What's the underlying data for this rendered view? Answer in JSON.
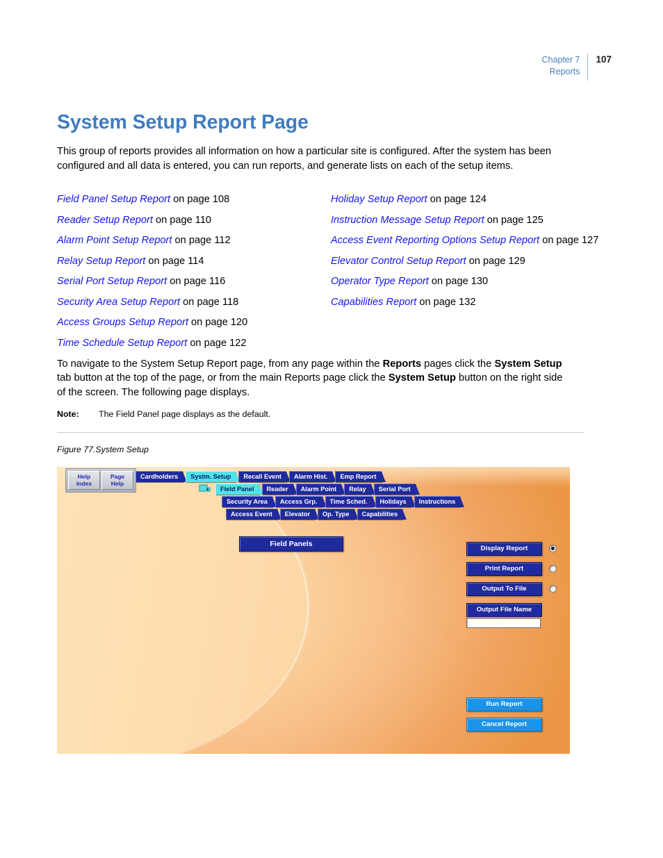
{
  "header": {
    "chapter": "Chapter 7",
    "section": "Reports",
    "page_number": "107"
  },
  "page": {
    "title": "System Setup Report Page",
    "intro": "This group of reports provides all information on how a particular site is configured. After the system has been configured and all data is entered, you can run reports, and generate lists on each of the setup items.",
    "navigate_1": "To navigate to the System Setup Report page, from any page within the ",
    "navigate_b1": "Reports",
    "navigate_2": " pages click the ",
    "navigate_b2": "System Setup",
    "navigate_3": " tab button at the top of the page, or from the main Reports page click the ",
    "navigate_b3": "System Setup",
    "navigate_4": " button on the right side of the screen. The following page displays.",
    "note_label": "Note:",
    "note_text": "The Field Panel page displays as the default.",
    "figure_caption": "Figure 77.System Setup"
  },
  "xref": {
    "left": [
      {
        "link": "Field Panel Setup Report",
        "tail": " on page 108"
      },
      {
        "link": "Reader Setup Report",
        "tail": " on page 110"
      },
      {
        "link": "Alarm Point Setup Report",
        "tail": " on page 112"
      },
      {
        "link": "Relay Setup Report",
        "tail": " on page 114"
      },
      {
        "link": "Serial Port Setup Report",
        "tail": " on page 116"
      },
      {
        "link": "Security Area Setup Report",
        "tail": " on page 118"
      },
      {
        "link": "Access Groups Setup Report",
        "tail": " on page 120"
      },
      {
        "link": "Time Schedule Setup Report",
        "tail": " on page 122"
      }
    ],
    "right": [
      {
        "link": "Holiday Setup Report",
        "tail": " on page 124"
      },
      {
        "link": "Instruction Message Setup Report",
        "tail": " on page 125"
      },
      {
        "link": "Access Event Reporting Options Setup Report",
        "tail": " on page 127"
      },
      {
        "link": "Elevator Control Setup Report",
        "tail": " on page 129"
      },
      {
        "link": "Operator Type Report",
        "tail": " on page 130"
      },
      {
        "link": "Capabilities Report",
        "tail": " on page 132"
      }
    ]
  },
  "appshot": {
    "help_buttons": [
      {
        "line1": "Help",
        "line2": "Index"
      },
      {
        "line1": "Page",
        "line2": "Help"
      }
    ],
    "tab_rows": [
      [
        {
          "label": "Cardholders",
          "active": false
        },
        {
          "label": "Systm. Setup",
          "active": true
        },
        {
          "label": "Recall Event",
          "active": false
        },
        {
          "label": "Alarm Hist.",
          "active": false
        },
        {
          "label": "Emp Report",
          "active": false
        }
      ],
      [
        {
          "label": "Field Panel",
          "active": true
        },
        {
          "label": "Reader",
          "active": false
        },
        {
          "label": "Alarm Point",
          "active": false
        },
        {
          "label": "Relay",
          "active": false
        },
        {
          "label": "Serial Port",
          "active": false
        }
      ],
      [
        {
          "label": "Security Area",
          "active": false
        },
        {
          "label": "Access Grp.",
          "active": false
        },
        {
          "label": "Time Sched.",
          "active": false
        },
        {
          "label": "Holidays",
          "active": false
        },
        {
          "label": "Instructions",
          "active": false
        }
      ],
      [
        {
          "label": "Access Event",
          "active": false
        },
        {
          "label": "Elevator",
          "active": false
        },
        {
          "label": "Op. Type",
          "active": false
        },
        {
          "label": "Capabilities",
          "active": false
        }
      ]
    ],
    "panel_heading": "Field Panels",
    "output_options": [
      {
        "label": "Display Report",
        "selected": true
      },
      {
        "label": "Print Report",
        "selected": false
      },
      {
        "label": "Output To File",
        "selected": false
      }
    ],
    "output_file_label": "Output File Name",
    "output_file_value": "",
    "run_buttons": [
      {
        "label": "Run Report"
      },
      {
        "label": "Cancel Report"
      }
    ],
    "colors": {
      "tab_blue": "#1f2a9c",
      "tab_active_cyan": "#4fe3e8",
      "run_blue": "#1b93e8",
      "background_orange": "#f0a35f"
    }
  }
}
